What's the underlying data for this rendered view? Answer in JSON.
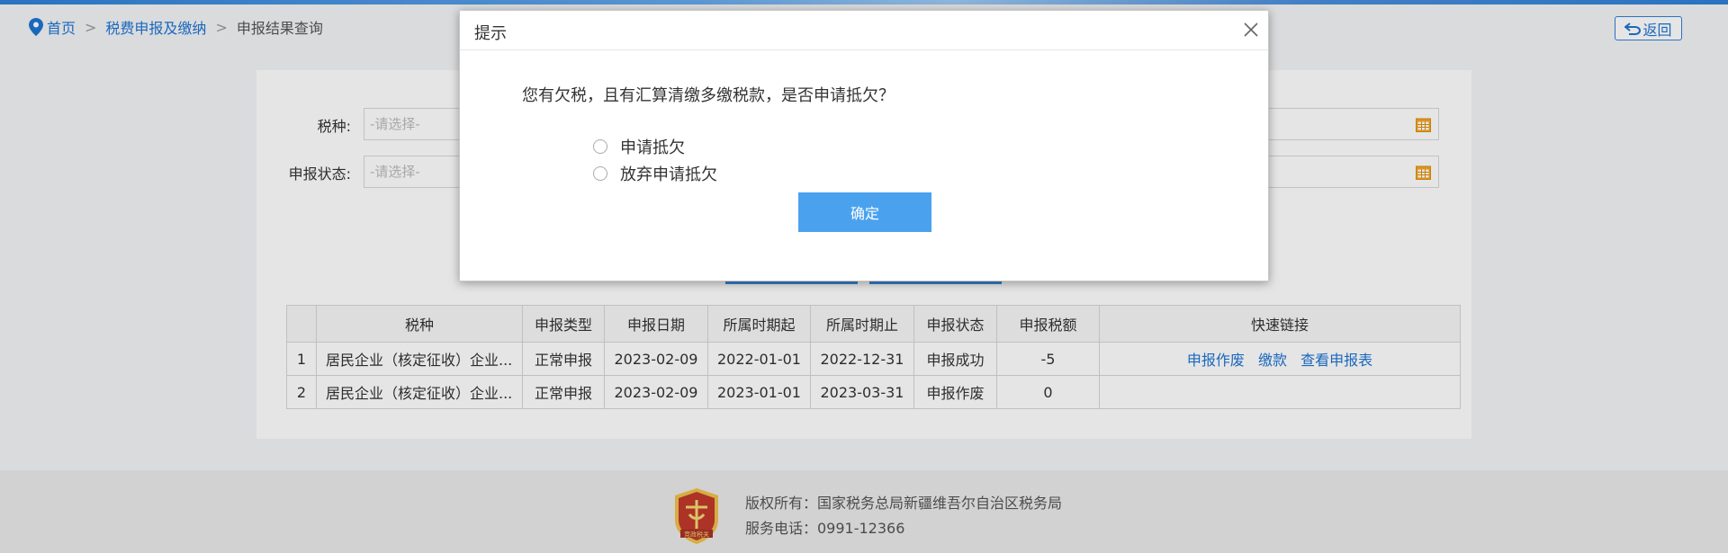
{
  "breadcrumb": {
    "home": "首页",
    "section": "税费申报及缴纳",
    "current": "申报结果查询",
    "sep": ">"
  },
  "header": {
    "back_label": "返回"
  },
  "form": {
    "tax_type_label": "税种:",
    "tax_type_placeholder": "-请选择-",
    "status_label": "申报状态:",
    "status_placeholder": "-请选择-"
  },
  "table": {
    "columns": [
      "",
      "税种",
      "申报类型",
      "申报日期",
      "所属时期起",
      "所属时期止",
      "申报状态",
      "申报税额",
      "快速链接"
    ],
    "rows": [
      {
        "no": "1",
        "tax": "居民企业（核定征收）企业...",
        "type": "正常申报",
        "date": "2023-02-09",
        "start": "2022-01-01",
        "end": "2022-12-31",
        "status": "申报成功",
        "amount": "-5",
        "links": [
          "申报作废",
          "缴款",
          "查看申报表"
        ]
      },
      {
        "no": "2",
        "tax": "居民企业（核定征收）企业...",
        "type": "正常申报",
        "date": "2023-02-09",
        "start": "2023-01-01",
        "end": "2023-03-31",
        "status": "申报作废",
        "amount": "0",
        "links": []
      }
    ]
  },
  "footer": {
    "copyright": "版权所有：国家税务总局新疆维吾尔自治区税务局",
    "phone": "服务电话：0991-12366",
    "badge_text": "竞政税关"
  },
  "dialog": {
    "title": "提示",
    "question": "您有欠税，且有汇算清缴多缴税款，是否申请抵欠？",
    "options": [
      "申请抵欠",
      "放弃申请抵欠"
    ],
    "confirm": "确定"
  },
  "colors": {
    "accent": "#1e74d3",
    "button": "#4aa2ef",
    "badge": "#c0392b"
  }
}
